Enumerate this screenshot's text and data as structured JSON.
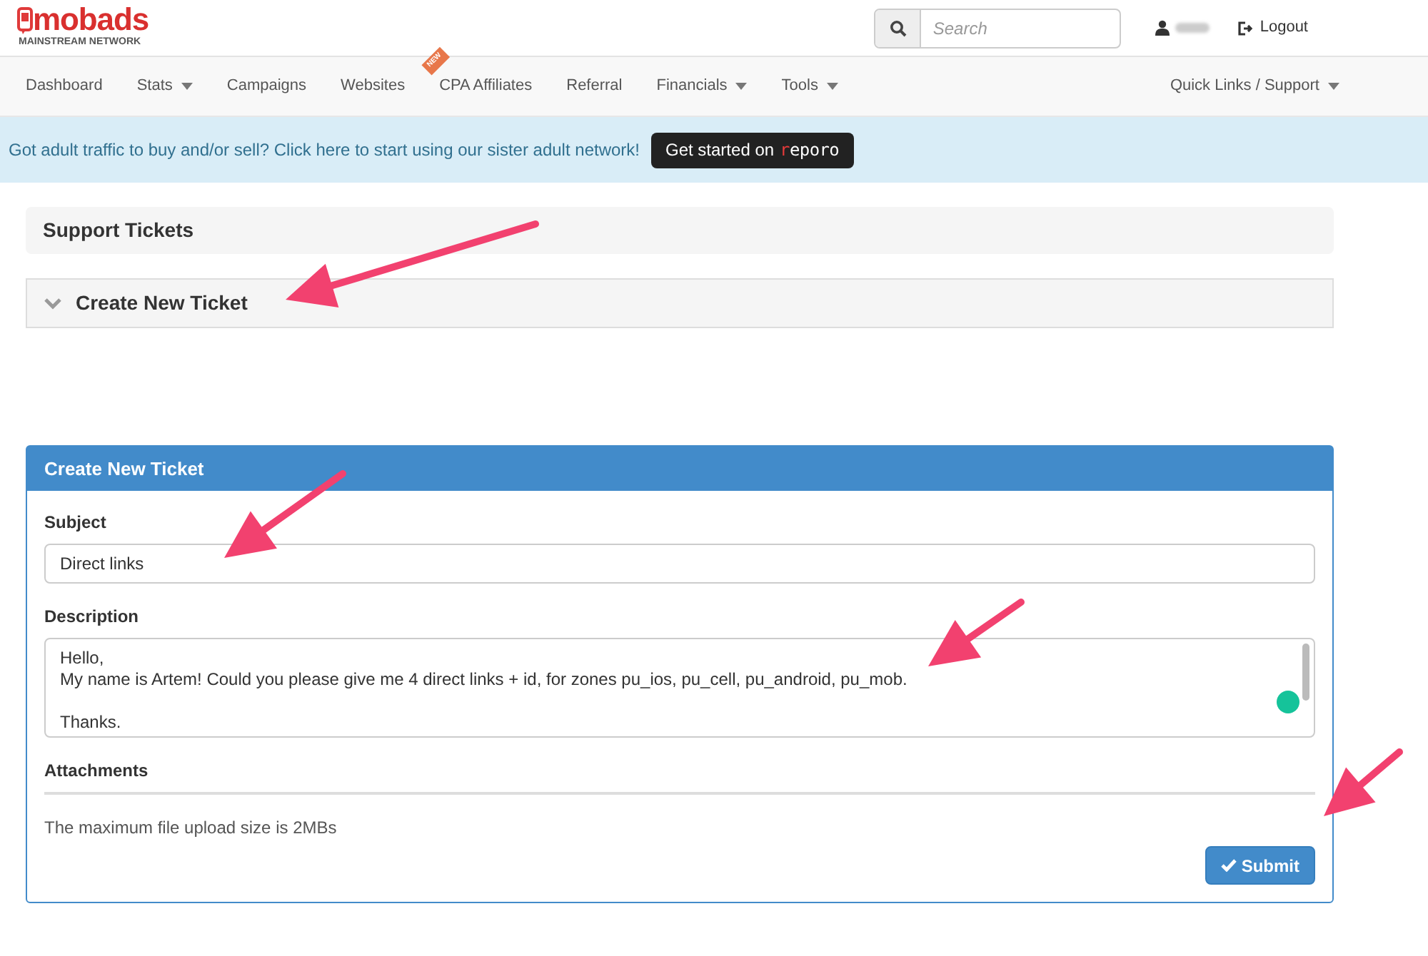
{
  "logo": {
    "name": "mobads",
    "tagline": "MAINSTREAM NETWORK"
  },
  "search": {
    "placeholder": "Search"
  },
  "logout": "Logout",
  "nav": [
    {
      "label": "Dashboard",
      "kind": "link"
    },
    {
      "label": "Stats",
      "kind": "dropdown"
    },
    {
      "label": "Campaigns",
      "kind": "link"
    },
    {
      "label": "Websites",
      "kind": "link"
    },
    {
      "label": "CPA Affiliates",
      "kind": "link",
      "badge": "NEW"
    },
    {
      "label": "Referral",
      "kind": "link"
    },
    {
      "label": "Financials",
      "kind": "dropdown"
    },
    {
      "label": "Tools",
      "kind": "dropdown"
    }
  ],
  "nav_right": {
    "label": "Quick Links / Support",
    "kind": "dropdown"
  },
  "banner": {
    "text": "Got adult traffic to buy and/or sell? Click here to start using our sister adult network!",
    "button": "Get started on",
    "button_logo": "reporo"
  },
  "support_panel": {
    "title": "Support Tickets"
  },
  "collapsible": {
    "title": "Create New Ticket",
    "expanded": false
  },
  "form": {
    "title": "Create New Ticket",
    "subject": {
      "label": "Subject",
      "value": "Direct links"
    },
    "description": {
      "label": "Description",
      "value": "Hello,\nMy name is Artem! Could you please give me 4 direct links + id, for zones pu_ios, pu_cell, pu_android, pu_mob.\n\nThanks."
    },
    "attachments": {
      "label": "Attachments",
      "note": "The maximum file upload size is 2MBs"
    },
    "submit": "Submit"
  }
}
